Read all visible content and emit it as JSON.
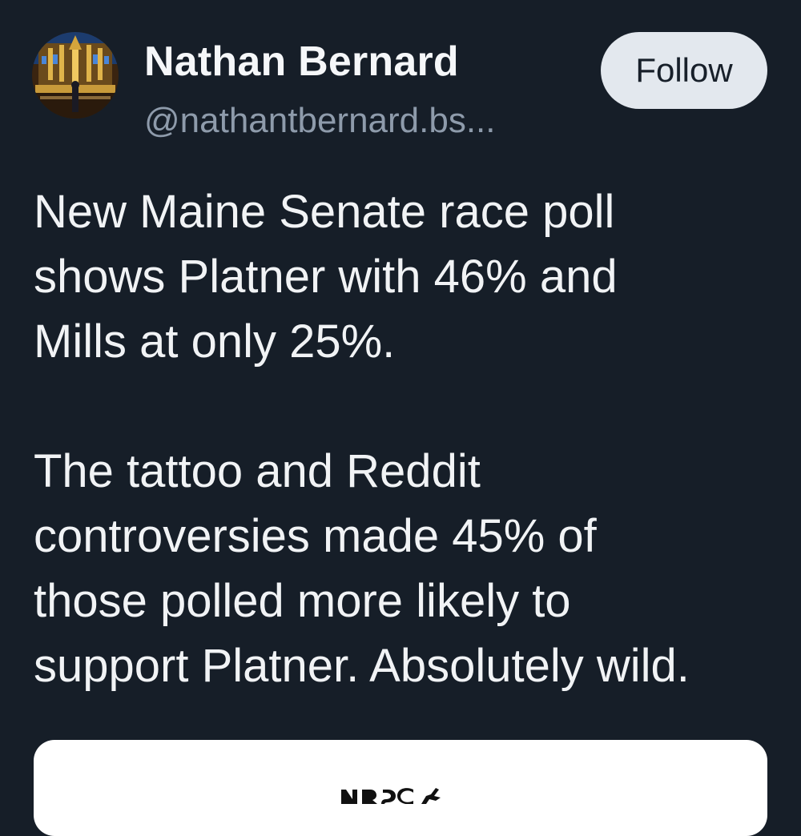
{
  "author": {
    "display_name": "Nathan Bernard",
    "handle": "@nathantbernard.bs...",
    "avatar": "cathedral-altar-avatar"
  },
  "follow_button": {
    "label": "Follow"
  },
  "post": {
    "paragraphs": [
      "New Maine Senate race poll\nshows Platner with 46% and\nMills at only 25%.",
      "The tattoo and Reddit\ncontroversies made 45% of\nthose polled more likely to\nsupport Platner. Absolutely wild."
    ]
  },
  "embed": {
    "logo": "NRSC logo"
  },
  "colors": {
    "background": "#161e28",
    "text": "#f1f3f5",
    "handle": "#8e9bab",
    "follow_button_bg": "#e3e8ee",
    "follow_button_text": "#18202a",
    "embed_card_bg": "#ffffff"
  }
}
